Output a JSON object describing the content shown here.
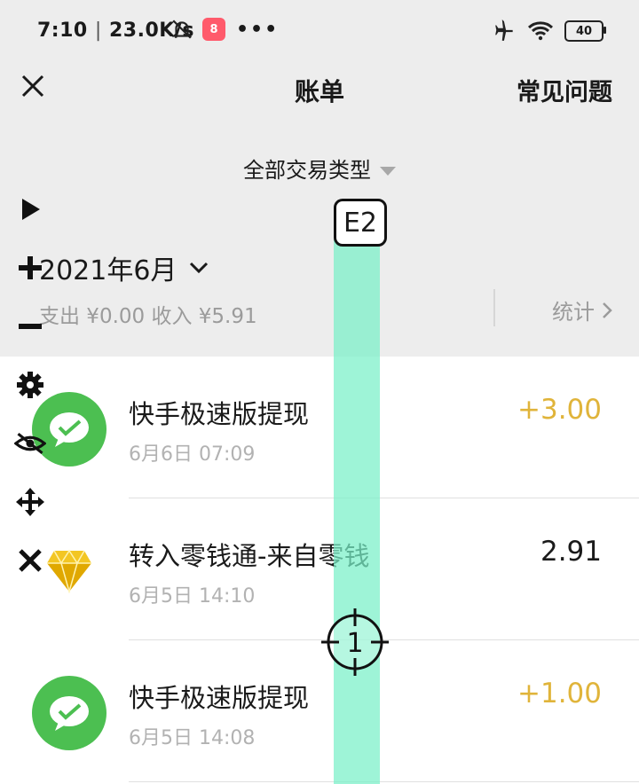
{
  "status_bar": {
    "time": "7:10",
    "speed": "23.0K/s",
    "battery": "40"
  },
  "nav": {
    "title": "账单",
    "faq": "常见问题"
  },
  "filter": {
    "label": "全部交易类型"
  },
  "summary": {
    "month": "2021年6月",
    "totals": "支出 ¥0.00 收入 ¥5.91",
    "stats_label": "统计"
  },
  "transactions": [
    {
      "title": "快手极速版提现",
      "time": "6月6日 07:09",
      "amount": "+3.00",
      "icon": "wechat-icon"
    },
    {
      "title": "转入零钱通-来自零钱",
      "time": "6月5日 14:10",
      "amount": "2.91",
      "icon": "diamond-icon"
    },
    {
      "title": "快手极速版提现",
      "time": "6月5日 14:08",
      "amount": "+1.00",
      "icon": "wechat-icon"
    }
  ],
  "overlay": {
    "label": "E2",
    "target": "1"
  },
  "colors": {
    "positive": "#e0b43a",
    "wechat": "#4cbf51",
    "overlay": "#78f0c8"
  }
}
